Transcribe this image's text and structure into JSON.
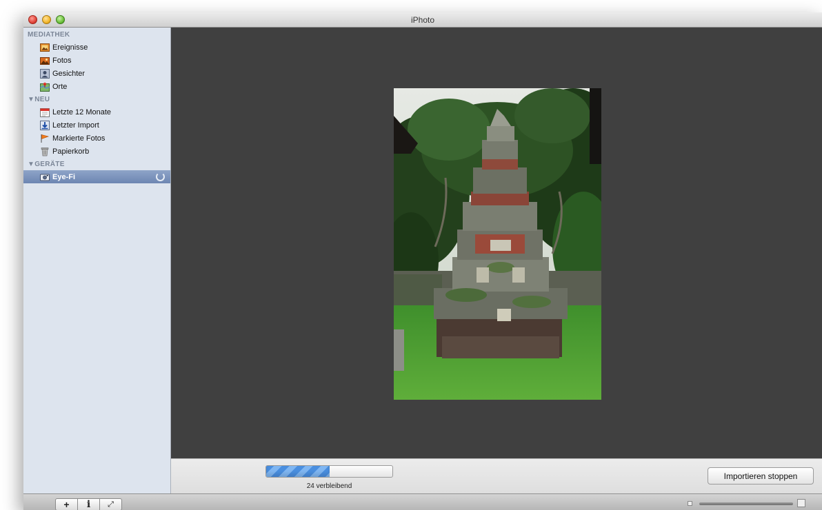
{
  "window": {
    "title": "iPhoto"
  },
  "sidebar": {
    "sections": [
      {
        "header": "MEDIATHEK",
        "items": [
          {
            "label": "Ereignisse",
            "icon": "events-icon"
          },
          {
            "label": "Fotos",
            "icon": "photos-icon"
          },
          {
            "label": "Gesichter",
            "icon": "faces-icon"
          },
          {
            "label": "Orte",
            "icon": "places-icon"
          }
        ]
      },
      {
        "header": "▼NEU",
        "items": [
          {
            "label": "Letzte 12 Monate",
            "icon": "calendar-icon"
          },
          {
            "label": "Letzter Import",
            "icon": "import-icon"
          },
          {
            "label": "Markierte Fotos",
            "icon": "flag-icon"
          },
          {
            "label": "Papierkorb",
            "icon": "trash-icon"
          }
        ]
      },
      {
        "header": "▼GERÄTE",
        "items": [
          {
            "label": "Eye-Fi",
            "icon": "camera-icon",
            "selected": true
          }
        ]
      }
    ]
  },
  "import": {
    "progress": 0.5,
    "remaining": "24 verbleibend",
    "stop_label": "Importieren stoppen"
  },
  "toolbar": {
    "add": "+",
    "info": "i",
    "fullscreen": "⤢"
  },
  "colors": {
    "sidebar_bg": "#dde4ee",
    "viewer_bg": "#404040",
    "selection": "#6d86b2",
    "progress": "#4a8fe0"
  }
}
